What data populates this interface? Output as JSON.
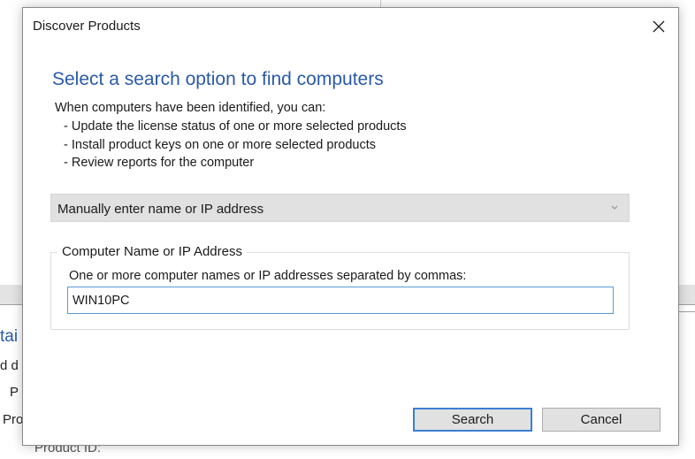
{
  "background": {
    "fragments": [
      "tai",
      "d d",
      "P",
      "Pro",
      "Product ID:"
    ]
  },
  "dialog": {
    "title": "Discover Products",
    "close_icon": "close-icon",
    "heading": "Select a search option to find computers",
    "intro": "When computers have been identified, you can:",
    "bullets": [
      "- Update the license status of one or more selected products",
      "- Install product keys on one or more selected products",
      "- Review reports for the computer"
    ],
    "search_option": {
      "selected": "Manually enter name or IP address",
      "icon": "chevron-down-icon"
    },
    "group": {
      "legend": "Computer Name or IP Address",
      "field_label": "One or more computer names or IP addresses separated by commas:",
      "field_value": "WIN10PC"
    },
    "buttons": {
      "search": "Search",
      "cancel": "Cancel"
    }
  },
  "colors": {
    "accent": "#2a5aa8",
    "focus_border": "#3c7fd4",
    "button_bg": "#e1e1e1"
  }
}
